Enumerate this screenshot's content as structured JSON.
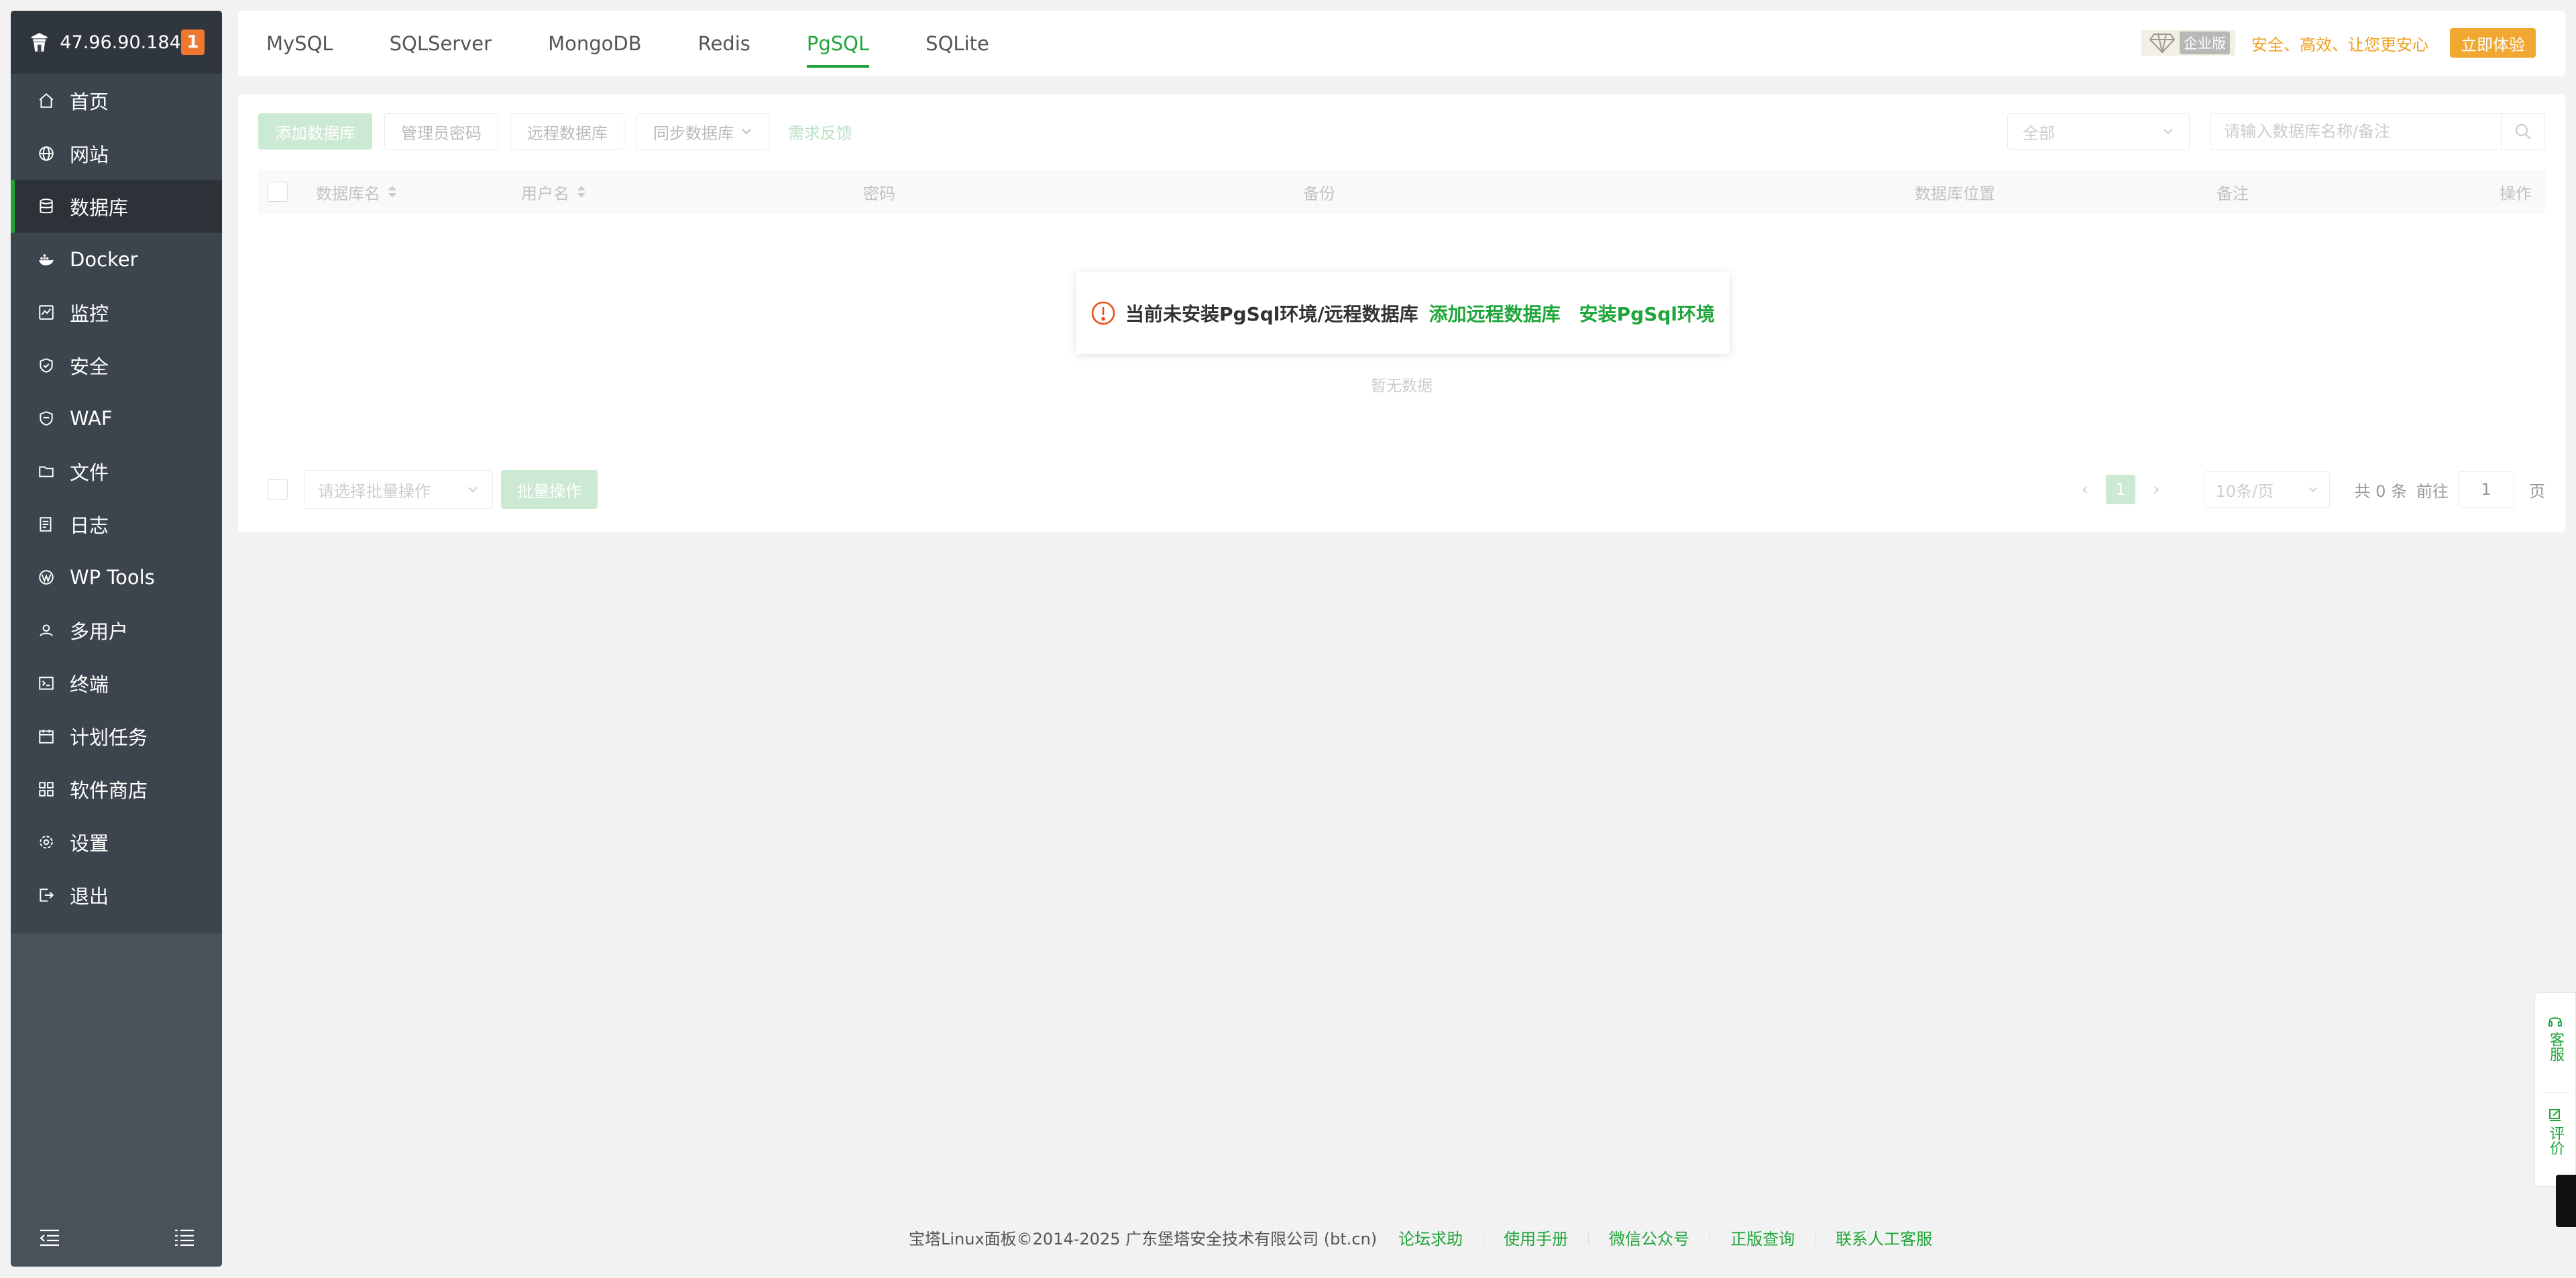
{
  "server": {
    "ip": "47.96.90.184",
    "badge": "1"
  },
  "nav": [
    {
      "key": "home",
      "label": "首页",
      "icon": "home-icon"
    },
    {
      "key": "site",
      "label": "网站",
      "icon": "globe-icon"
    },
    {
      "key": "database",
      "label": "数据库",
      "icon": "database-icon",
      "active": true
    },
    {
      "key": "docker",
      "label": "Docker",
      "icon": "docker-icon"
    },
    {
      "key": "monitor",
      "label": "监控",
      "icon": "monitor-icon"
    },
    {
      "key": "security",
      "label": "安全",
      "icon": "shield-icon"
    },
    {
      "key": "waf",
      "label": "WAF",
      "icon": "waf-shield-icon"
    },
    {
      "key": "files",
      "label": "文件",
      "icon": "folder-icon"
    },
    {
      "key": "logs",
      "label": "日志",
      "icon": "log-icon"
    },
    {
      "key": "wptools",
      "label": "WP Tools",
      "icon": "wordpress-icon"
    },
    {
      "key": "multiuser",
      "label": "多用户",
      "icon": "users-icon"
    },
    {
      "key": "terminal",
      "label": "终端",
      "icon": "terminal-icon"
    },
    {
      "key": "cron",
      "label": "计划任务",
      "icon": "calendar-icon"
    },
    {
      "key": "store",
      "label": "软件商店",
      "icon": "apps-grid-icon"
    },
    {
      "key": "settings",
      "label": "设置",
      "icon": "gear-icon"
    },
    {
      "key": "logout",
      "label": "退出",
      "icon": "logout-icon"
    }
  ],
  "tabs": [
    {
      "label": "MySQL"
    },
    {
      "label": "SQLServer"
    },
    {
      "label": "MongoDB"
    },
    {
      "label": "Redis"
    },
    {
      "label": "PgSQL",
      "active": true
    },
    {
      "label": "SQLite"
    }
  ],
  "promo": {
    "edition": "企业版",
    "slogan": "安全、高效、让您更安心",
    "try_label": "立即体验"
  },
  "toolbar": {
    "add_db": "添加数据库",
    "admin_pwd": "管理员密码",
    "remote_db": "远程数据库",
    "sync_db": "同步数据库",
    "feedback": "需求反馈",
    "filter_value": "全部",
    "search_placeholder": "请输入数据库名称/备注"
  },
  "table": {
    "columns": [
      "数据库名",
      "用户名",
      "密码",
      "备份",
      "数据库位置",
      "备注",
      "操作"
    ],
    "empty_text": "暂无数据"
  },
  "notice": {
    "message": "当前未安装PgSql环境/远程数据库",
    "link_remote": "添加远程数据库",
    "link_install": "安装PgSql环境"
  },
  "pager": {
    "batch_placeholder": "请选择批量操作",
    "batch_button": "批量操作",
    "prev": "‹",
    "current": "1",
    "next": "›",
    "page_size": "10条/页",
    "total": "共 0 条",
    "goto_label": "前往",
    "goto_value": "1",
    "page_suffix": "页"
  },
  "footer": {
    "copyright": "宝塔Linux面板©2014-2025 广东堡塔安全技术有限公司 (bt.cn)",
    "links": [
      "论坛求助",
      "使用手册",
      "微信公众号",
      "正版查询",
      "联系人工客服"
    ]
  },
  "float": {
    "service": "客服",
    "review": "评价"
  },
  "colors": {
    "brand": "#20a53a",
    "sidebar": "#3c444d",
    "accent_orange": "#f0772e",
    "promo_gold": "#f0a830"
  }
}
